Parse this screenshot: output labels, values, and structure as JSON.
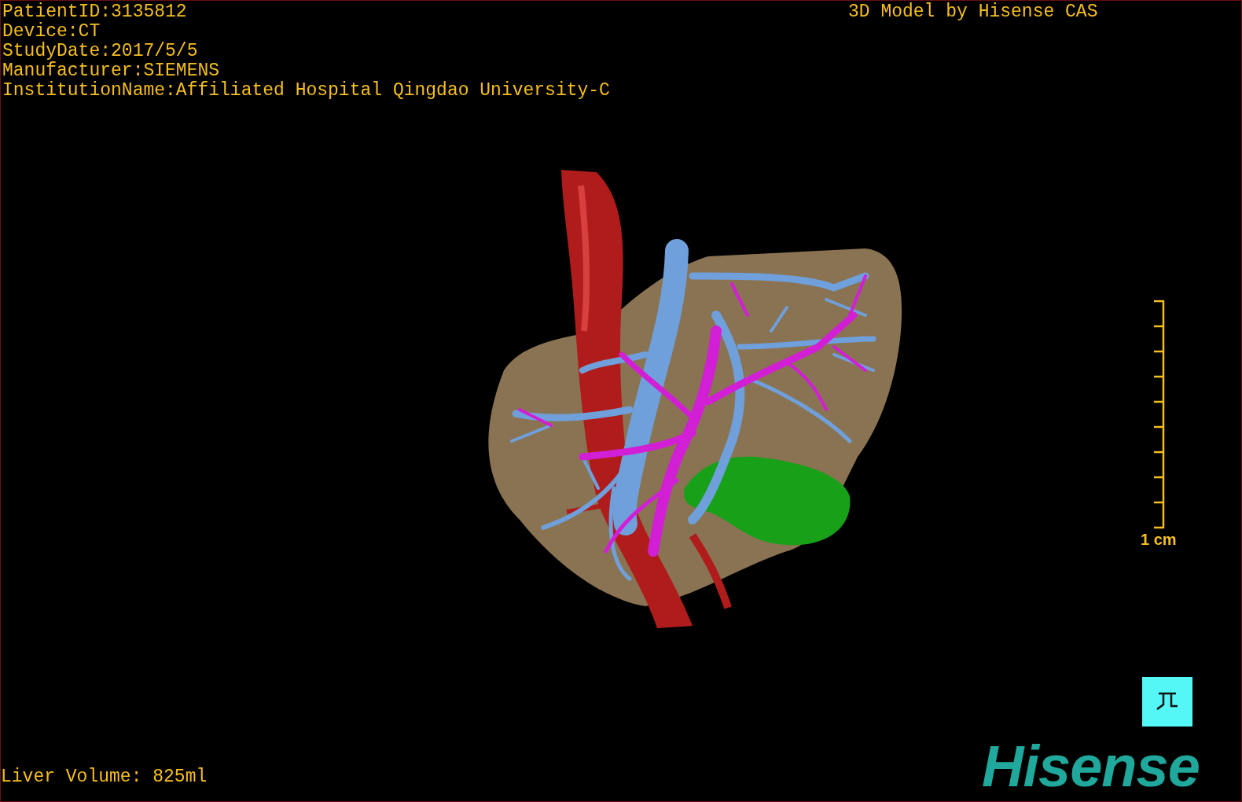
{
  "patient_info": [
    "PatientID:3135812",
    "Device:CT",
    "StudyDate:2017/5/5",
    "Manufacturer:SIEMENS",
    "InstitutionName:Affiliated Hospital Qingdao University-C"
  ],
  "model_caption": "3D Model by Hisense CAS",
  "scale_bar": {
    "label": "1 cm"
  },
  "liver_volume": "Liver Volume: 825ml",
  "logo": "Hisense"
}
